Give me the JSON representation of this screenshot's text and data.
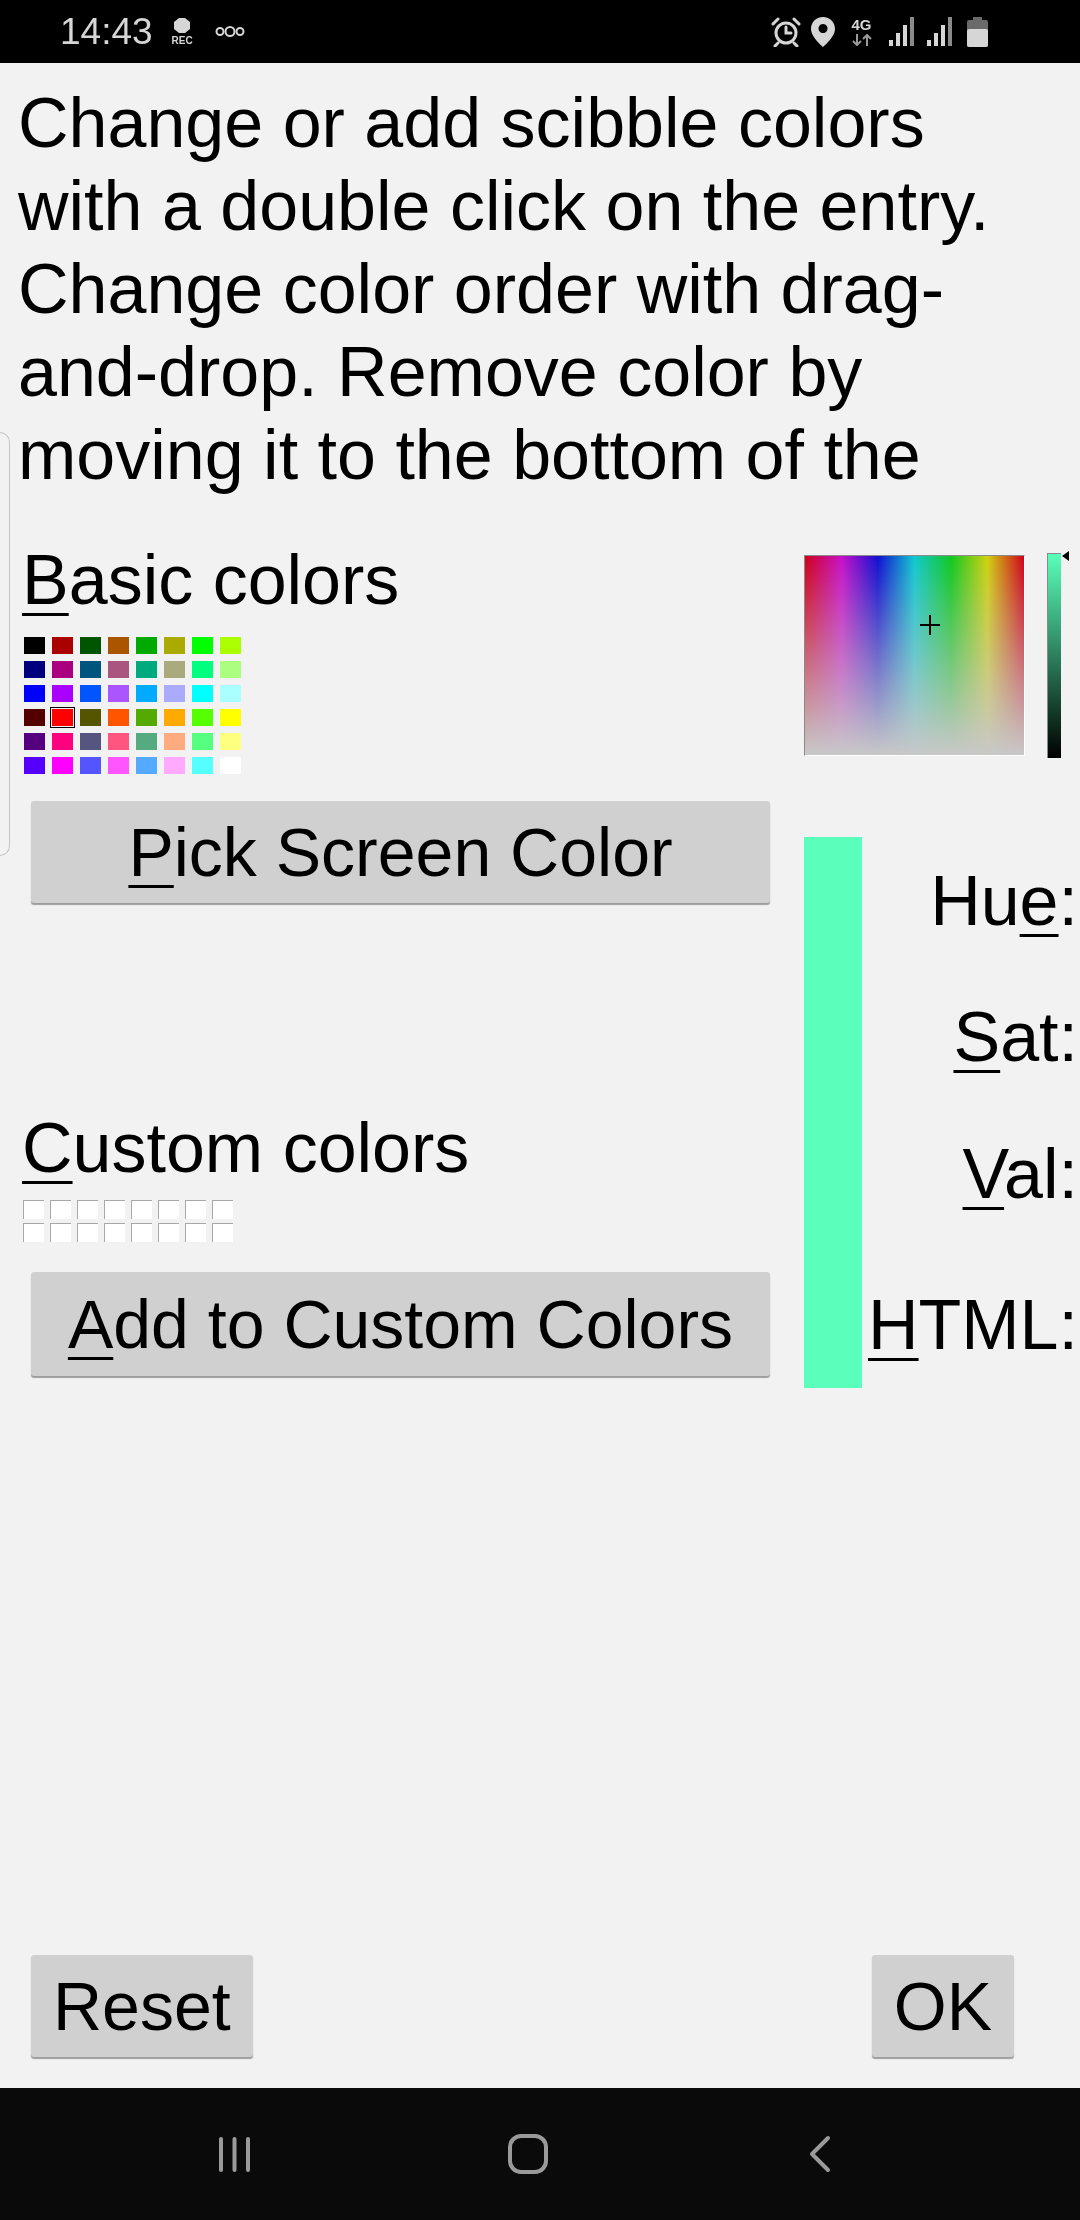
{
  "status_bar": {
    "time": "14:43",
    "recording_label": "REC",
    "network_type": "4G"
  },
  "instructions": "Change or add scibble colors with a double click on the entry. Change color order with drag-and-drop. Remove color by moving it to the bottom of the",
  "basic_colors": {
    "label": {
      "underlined": "B",
      "after": "asic colors"
    },
    "swatches": [
      {
        "color": "#000000",
        "selected": false
      },
      {
        "color": "#aa0000",
        "selected": false
      },
      {
        "color": "#005500",
        "selected": false
      },
      {
        "color": "#aa5500",
        "selected": false
      },
      {
        "color": "#00aa00",
        "selected": false
      },
      {
        "color": "#aaaa00",
        "selected": false
      },
      {
        "color": "#00ff00",
        "selected": false
      },
      {
        "color": "#aaff00",
        "selected": false
      },
      {
        "color": "#00007f",
        "selected": false
      },
      {
        "color": "#aa007f",
        "selected": false
      },
      {
        "color": "#00557f",
        "selected": false
      },
      {
        "color": "#aa557f",
        "selected": false
      },
      {
        "color": "#00aa7f",
        "selected": false
      },
      {
        "color": "#aaaa7f",
        "selected": false
      },
      {
        "color": "#00ff7f",
        "selected": false
      },
      {
        "color": "#aaff7f",
        "selected": false
      },
      {
        "color": "#0000ff",
        "selected": false
      },
      {
        "color": "#aa00ff",
        "selected": false
      },
      {
        "color": "#0055ff",
        "selected": false
      },
      {
        "color": "#aa55ff",
        "selected": false
      },
      {
        "color": "#00aaff",
        "selected": false
      },
      {
        "color": "#aaaaff",
        "selected": false
      },
      {
        "color": "#00ffff",
        "selected": false
      },
      {
        "color": "#aaffff",
        "selected": false
      },
      {
        "color": "#550000",
        "selected": false
      },
      {
        "color": "#ff0000",
        "selected": true
      },
      {
        "color": "#555500",
        "selected": false
      },
      {
        "color": "#ff5500",
        "selected": false
      },
      {
        "color": "#55aa00",
        "selected": false
      },
      {
        "color": "#ffaa00",
        "selected": false
      },
      {
        "color": "#55ff00",
        "selected": false
      },
      {
        "color": "#ffff00",
        "selected": false
      },
      {
        "color": "#55007f",
        "selected": false
      },
      {
        "color": "#ff007f",
        "selected": false
      },
      {
        "color": "#55557f",
        "selected": false
      },
      {
        "color": "#ff557f",
        "selected": false
      },
      {
        "color": "#55aa7f",
        "selected": false
      },
      {
        "color": "#ffaa7f",
        "selected": false
      },
      {
        "color": "#55ff7f",
        "selected": false
      },
      {
        "color": "#ffff7f",
        "selected": false
      },
      {
        "color": "#5500ff",
        "selected": false
      },
      {
        "color": "#ff00ff",
        "selected": false
      },
      {
        "color": "#5555ff",
        "selected": false
      },
      {
        "color": "#ff55ff",
        "selected": false
      },
      {
        "color": "#55aaff",
        "selected": false
      },
      {
        "color": "#ffaaff",
        "selected": false
      },
      {
        "color": "#55ffff",
        "selected": false
      },
      {
        "color": "#ffffff",
        "selected": false
      }
    ]
  },
  "pick_screen_color_button": {
    "label": {
      "underlined": "P",
      "after": "ick Screen Color"
    }
  },
  "custom_colors": {
    "label": {
      "underlined": "C",
      "after": "ustom colors"
    },
    "swatches": [
      {
        "color": "#ffffff"
      },
      {
        "color": "#ffffff"
      },
      {
        "color": "#ffffff"
      },
      {
        "color": "#ffffff"
      },
      {
        "color": "#ffffff"
      },
      {
        "color": "#ffffff"
      },
      {
        "color": "#ffffff"
      },
      {
        "color": "#ffffff"
      },
      {
        "color": "#ffffff"
      },
      {
        "color": "#ffffff"
      },
      {
        "color": "#ffffff"
      },
      {
        "color": "#ffffff"
      },
      {
        "color": "#ffffff"
      },
      {
        "color": "#ffffff"
      },
      {
        "color": "#ffffff"
      },
      {
        "color": "#ffffff"
      }
    ]
  },
  "add_to_custom_colors_button": {
    "label": {
      "underlined": "A",
      "after": "dd to Custom Colors"
    }
  },
  "color_picker": {
    "color": "#59ffba",
    "value_slider": {
      "level": 1
    }
  },
  "field_labels": [
    {
      "before": "Hu",
      "underlined": "e",
      "after": ":"
    },
    {
      "underlined": "S",
      "after": "at:"
    },
    {
      "underlined": "V",
      "after": "al:"
    },
    {
      "underlined": "H",
      "after": "TML:"
    }
  ],
  "dialog_buttons": [
    {
      "label": "Reset"
    },
    {
      "label": "OK"
    }
  ]
}
